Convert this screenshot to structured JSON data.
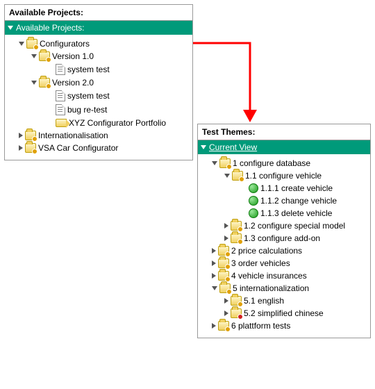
{
  "panel1": {
    "title": "Available Projects:",
    "band": "Available Projects:",
    "n0": "Configurators",
    "n1": "Version 1.0",
    "n2": "system test",
    "n3": "Version 2.0",
    "n4": "system test",
    "n5": "bug re-test",
    "n6": "XYZ Configurator Portfolio",
    "n7": "Internationalisation",
    "n8": "VSA Car Configurator"
  },
  "panel2": {
    "title": "Test Themes:",
    "band": "Current View",
    "n0": "1 configure database",
    "n1": "1.1 configure vehicle",
    "n2": "1.1.1 create vehicle",
    "n3": "1.1.2 change vehicle",
    "n4": "1.1.3 delete vehicle",
    "n5": "1.2 configure special model",
    "n6": "1.3 configure add-on",
    "n7": "2 price calculations",
    "n8": "3 order vehicles",
    "n9": "4 vehicle insurances",
    "n10": "5 internationalization",
    "n11": "5.1 english",
    "n12": "5.2 simplified chinese",
    "n13": "6 plattform tests"
  }
}
